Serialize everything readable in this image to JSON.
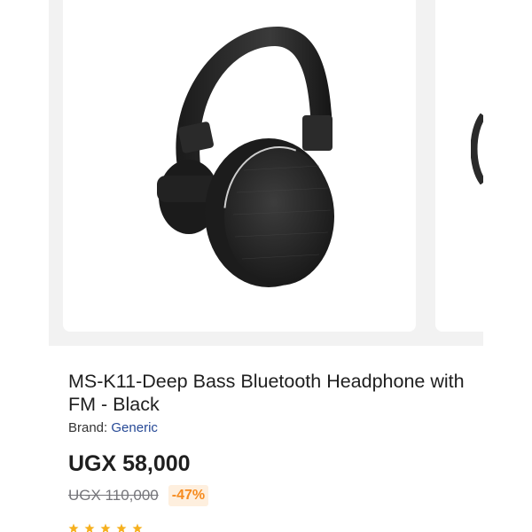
{
  "product": {
    "image_icon": "headphones-image",
    "title": "MS-K11-Deep Bass Bluetooth Headphone with FM -  Black",
    "brand_label": "Brand:",
    "brand_name": "Generic",
    "price": "UGX 58,000",
    "old_price": "UGX 110,000",
    "discount": "-47%",
    "rating_icon": "star-icon"
  },
  "colors": {
    "accent": "#f68b1e",
    "brand_link": "#264996",
    "gallery_bg": "#f2f2f2",
    "star": "#f6b01e"
  }
}
